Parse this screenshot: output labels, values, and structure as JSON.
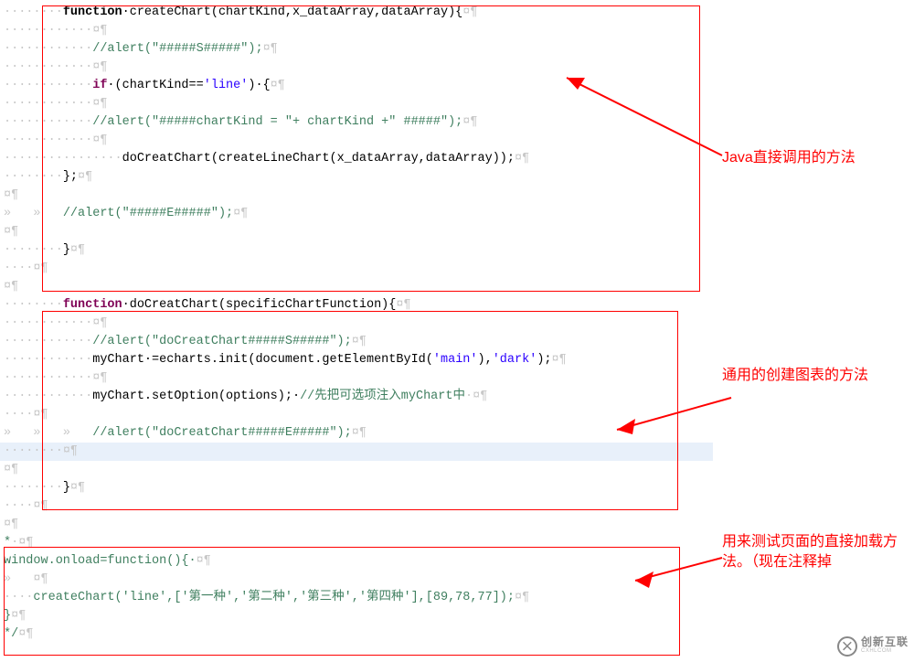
{
  "marks": {
    "dots8": "········",
    "dots4": "····",
    "tab": "»   ",
    "pilcrow": "¶",
    "box": "¤"
  },
  "code": {
    "l01a": "function",
    "l01b": "·createChart(chartKind,x_dataArray,dataArray){",
    "l03": "//alert(\"#####S#####\");",
    "l05a": "if",
    "l05b": "·(chartKind==",
    "l05c": "'line'",
    "l05d": ")·{",
    "l07a": "//alert(\"#####chartKind = \"+ chartKind +\" #####\");",
    "l09": "doCreatChart(createLineChart(x_dataArray,dataArray));",
    "l10": "};",
    "l12": "//alert(\"#####E#####\");",
    "l14": "}",
    "l17a": "function",
    "l17b": "·doCreatChart(specificChartFunction){",
    "l19": "//alert(\"doCreatChart#####S#####\");",
    "l20a": "myChart·=echarts.init(document.getElementById(",
    "l20b": "'main'",
    "l20c": "),",
    "l20d": "'dark'",
    "l20e": ");",
    "l22a": "myChart.setOption(options);·",
    "l22b": "//先把可选项注入myChart中",
    "l24": "//alert(\"doCreatChart#####E#####\");",
    "l27": "}",
    "l29": "*",
    "l30": "window.onload=function(){·",
    "l32a": "createChart(",
    "l32b": "'line'",
    "l32c": ",[",
    "l32d": "'第一种'",
    "l32e": ",",
    "l32f": "'第二种'",
    "l32g": ",",
    "l32h": "'第三种'",
    "l32i": ",",
    "l32j": "'第四种'",
    "l32k": "],[89,78,77]);",
    "l34": "*/"
  },
  "annotations": {
    "a1": "Java直接调用的方法",
    "a2": "通用的创建图表的方法",
    "a3": "用来测试页面的直接加载方法。（现在注释掉"
  },
  "logo": {
    "main": "创新互联",
    "sub": "CXHLCOM"
  }
}
